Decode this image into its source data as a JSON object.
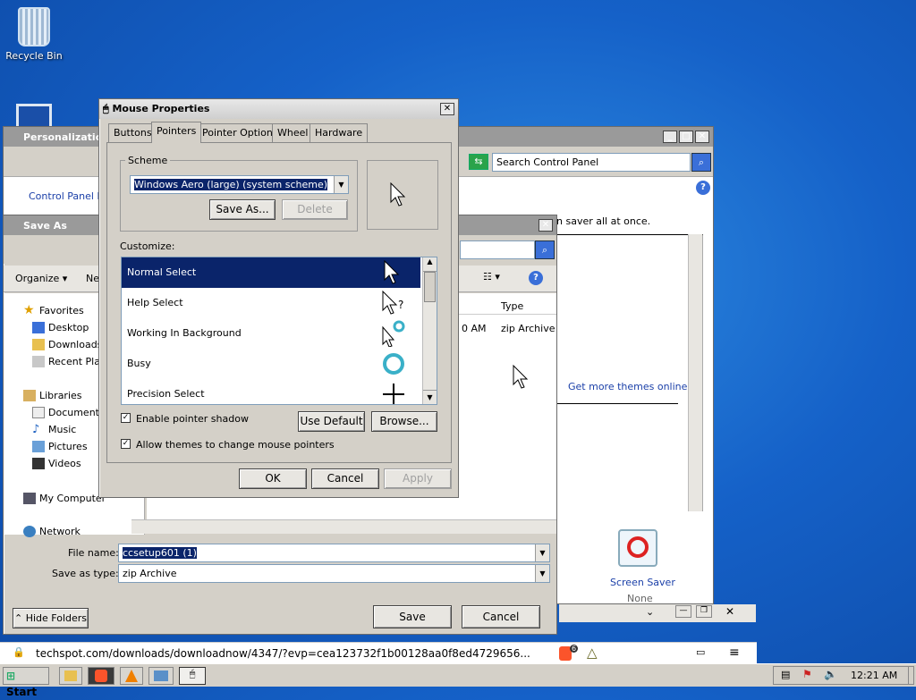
{
  "desktop": {
    "recycle_bin_label": "Recycle Bin"
  },
  "personalization": {
    "title": "Personalization",
    "search_placeholder": "Search Control Panel",
    "control_panel_home": "Control Panel Ho",
    "screen_saver_text": "n saver all at once.",
    "get_more_themes": "Get more themes online",
    "screen_saver_label": "Screen Saver",
    "screen_saver_value": "None"
  },
  "save_as": {
    "title": "Save As",
    "organize_label": "Organize",
    "new_folder_label": "Ne",
    "sidebar": {
      "favorites": "Favorites",
      "desktop": "Desktop",
      "downloads": "Downloads",
      "recent_places": "Recent Plac",
      "libraries": "Libraries",
      "documents": "Documents",
      "music": "Music",
      "pictures": "Pictures",
      "videos": "Videos",
      "my_computer": "My Computer",
      "network": "Network"
    },
    "columns": {
      "type": "Type"
    },
    "file_row": {
      "time_fragment": "0 AM",
      "type": "zip Archive"
    },
    "file_name_label": "File name:",
    "file_name_value": "ccsetup601 (1)",
    "save_as_type_label": "Save as type:",
    "save_as_type_value": "zip Archive",
    "hide_folders_label": "Hide Folders",
    "save_label": "Save",
    "cancel_label": "Cancel"
  },
  "mouse_props": {
    "title": "Mouse Properties",
    "tabs": [
      "Buttons",
      "Pointers",
      "Pointer Options",
      "Wheel",
      "Hardware"
    ],
    "scheme_label": "Scheme",
    "scheme_value": "Windows Aero (large) (system scheme)",
    "save_as_label": "Save As...",
    "delete_label": "Delete",
    "customize_label": "Customize:",
    "pointers": [
      "Normal Select",
      "Help Select",
      "Working In Background",
      "Busy",
      "Precision Select"
    ],
    "enable_shadow_label": "Enable pointer shadow",
    "allow_themes_label": "Allow themes to change mouse pointers",
    "use_default_label": "Use Default",
    "browse_label": "Browse...",
    "ok_label": "OK",
    "cancel_label": "Cancel",
    "apply_label": "Apply"
  },
  "browser_bar": {
    "url": "techspot.com/downloads/downloadnow/4347/?evp=cea123732f1b00128aa0f8ed4729656...",
    "badge_count": "6"
  },
  "taskbar": {
    "start_label": "Start",
    "clock": "12:21 AM"
  },
  "colors": {
    "selection": "#0a246a",
    "desktop": "#1561c8",
    "link": "#1a3fa8"
  }
}
